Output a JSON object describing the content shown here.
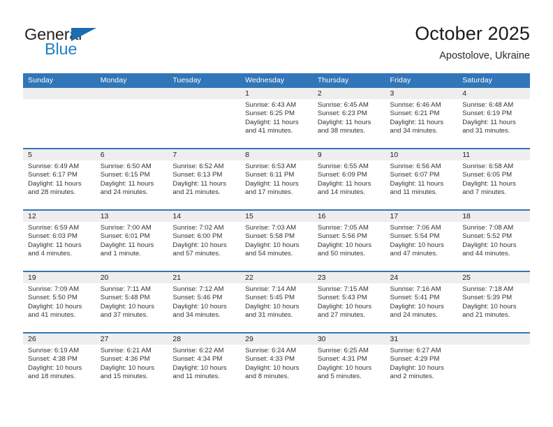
{
  "brand": {
    "name_part1": "General",
    "name_part2": "Blue",
    "color_dark": "#231f20",
    "color_blue": "#1f7fc4",
    "triangle_icon": "triangle-icon"
  },
  "header": {
    "title": "October 2025",
    "subtitle": "Apostolove, Ukraine"
  },
  "colors": {
    "header_blue": "#3176b8",
    "daystrip_gray": "#eeeeee",
    "text": "#333333"
  },
  "labels": {
    "sunrise": "Sunrise:",
    "sunset": "Sunset:",
    "daylight": "Daylight:"
  },
  "day_headers": [
    "Sunday",
    "Monday",
    "Tuesday",
    "Wednesday",
    "Thursday",
    "Friday",
    "Saturday"
  ],
  "weeks": [
    [
      {
        "day": "",
        "blank": true
      },
      {
        "day": "",
        "blank": true
      },
      {
        "day": "",
        "blank": true
      },
      {
        "day": "1",
        "sunrise": "Sunrise: 6:43 AM",
        "sunset": "Sunset: 6:25 PM",
        "daylight_l1": "Daylight: 11 hours",
        "daylight_l2": "and 41 minutes."
      },
      {
        "day": "2",
        "sunrise": "Sunrise: 6:45 AM",
        "sunset": "Sunset: 6:23 PM",
        "daylight_l1": "Daylight: 11 hours",
        "daylight_l2": "and 38 minutes."
      },
      {
        "day": "3",
        "sunrise": "Sunrise: 6:46 AM",
        "sunset": "Sunset: 6:21 PM",
        "daylight_l1": "Daylight: 11 hours",
        "daylight_l2": "and 34 minutes."
      },
      {
        "day": "4",
        "sunrise": "Sunrise: 6:48 AM",
        "sunset": "Sunset: 6:19 PM",
        "daylight_l1": "Daylight: 11 hours",
        "daylight_l2": "and 31 minutes."
      }
    ],
    [
      {
        "day": "5",
        "sunrise": "Sunrise: 6:49 AM",
        "sunset": "Sunset: 6:17 PM",
        "daylight_l1": "Daylight: 11 hours",
        "daylight_l2": "and 28 minutes."
      },
      {
        "day": "6",
        "sunrise": "Sunrise: 6:50 AM",
        "sunset": "Sunset: 6:15 PM",
        "daylight_l1": "Daylight: 11 hours",
        "daylight_l2": "and 24 minutes."
      },
      {
        "day": "7",
        "sunrise": "Sunrise: 6:52 AM",
        "sunset": "Sunset: 6:13 PM",
        "daylight_l1": "Daylight: 11 hours",
        "daylight_l2": "and 21 minutes."
      },
      {
        "day": "8",
        "sunrise": "Sunrise: 6:53 AM",
        "sunset": "Sunset: 6:11 PM",
        "daylight_l1": "Daylight: 11 hours",
        "daylight_l2": "and 17 minutes."
      },
      {
        "day": "9",
        "sunrise": "Sunrise: 6:55 AM",
        "sunset": "Sunset: 6:09 PM",
        "daylight_l1": "Daylight: 11 hours",
        "daylight_l2": "and 14 minutes."
      },
      {
        "day": "10",
        "sunrise": "Sunrise: 6:56 AM",
        "sunset": "Sunset: 6:07 PM",
        "daylight_l1": "Daylight: 11 hours",
        "daylight_l2": "and 11 minutes."
      },
      {
        "day": "11",
        "sunrise": "Sunrise: 6:58 AM",
        "sunset": "Sunset: 6:05 PM",
        "daylight_l1": "Daylight: 11 hours",
        "daylight_l2": "and 7 minutes."
      }
    ],
    [
      {
        "day": "12",
        "sunrise": "Sunrise: 6:59 AM",
        "sunset": "Sunset: 6:03 PM",
        "daylight_l1": "Daylight: 11 hours",
        "daylight_l2": "and 4 minutes."
      },
      {
        "day": "13",
        "sunrise": "Sunrise: 7:00 AM",
        "sunset": "Sunset: 6:01 PM",
        "daylight_l1": "Daylight: 11 hours",
        "daylight_l2": "and 1 minute."
      },
      {
        "day": "14",
        "sunrise": "Sunrise: 7:02 AM",
        "sunset": "Sunset: 6:00 PM",
        "daylight_l1": "Daylight: 10 hours",
        "daylight_l2": "and 57 minutes."
      },
      {
        "day": "15",
        "sunrise": "Sunrise: 7:03 AM",
        "sunset": "Sunset: 5:58 PM",
        "daylight_l1": "Daylight: 10 hours",
        "daylight_l2": "and 54 minutes."
      },
      {
        "day": "16",
        "sunrise": "Sunrise: 7:05 AM",
        "sunset": "Sunset: 5:56 PM",
        "daylight_l1": "Daylight: 10 hours",
        "daylight_l2": "and 50 minutes."
      },
      {
        "day": "17",
        "sunrise": "Sunrise: 7:06 AM",
        "sunset": "Sunset: 5:54 PM",
        "daylight_l1": "Daylight: 10 hours",
        "daylight_l2": "and 47 minutes."
      },
      {
        "day": "18",
        "sunrise": "Sunrise: 7:08 AM",
        "sunset": "Sunset: 5:52 PM",
        "daylight_l1": "Daylight: 10 hours",
        "daylight_l2": "and 44 minutes."
      }
    ],
    [
      {
        "day": "19",
        "sunrise": "Sunrise: 7:09 AM",
        "sunset": "Sunset: 5:50 PM",
        "daylight_l1": "Daylight: 10 hours",
        "daylight_l2": "and 41 minutes."
      },
      {
        "day": "20",
        "sunrise": "Sunrise: 7:11 AM",
        "sunset": "Sunset: 5:48 PM",
        "daylight_l1": "Daylight: 10 hours",
        "daylight_l2": "and 37 minutes."
      },
      {
        "day": "21",
        "sunrise": "Sunrise: 7:12 AM",
        "sunset": "Sunset: 5:46 PM",
        "daylight_l1": "Daylight: 10 hours",
        "daylight_l2": "and 34 minutes."
      },
      {
        "day": "22",
        "sunrise": "Sunrise: 7:14 AM",
        "sunset": "Sunset: 5:45 PM",
        "daylight_l1": "Daylight: 10 hours",
        "daylight_l2": "and 31 minutes."
      },
      {
        "day": "23",
        "sunrise": "Sunrise: 7:15 AM",
        "sunset": "Sunset: 5:43 PM",
        "daylight_l1": "Daylight: 10 hours",
        "daylight_l2": "and 27 minutes."
      },
      {
        "day": "24",
        "sunrise": "Sunrise: 7:16 AM",
        "sunset": "Sunset: 5:41 PM",
        "daylight_l1": "Daylight: 10 hours",
        "daylight_l2": "and 24 minutes."
      },
      {
        "day": "25",
        "sunrise": "Sunrise: 7:18 AM",
        "sunset": "Sunset: 5:39 PM",
        "daylight_l1": "Daylight: 10 hours",
        "daylight_l2": "and 21 minutes."
      }
    ],
    [
      {
        "day": "26",
        "sunrise": "Sunrise: 6:19 AM",
        "sunset": "Sunset: 4:38 PM",
        "daylight_l1": "Daylight: 10 hours",
        "daylight_l2": "and 18 minutes."
      },
      {
        "day": "27",
        "sunrise": "Sunrise: 6:21 AM",
        "sunset": "Sunset: 4:36 PM",
        "daylight_l1": "Daylight: 10 hours",
        "daylight_l2": "and 15 minutes."
      },
      {
        "day": "28",
        "sunrise": "Sunrise: 6:22 AM",
        "sunset": "Sunset: 4:34 PM",
        "daylight_l1": "Daylight: 10 hours",
        "daylight_l2": "and 11 minutes."
      },
      {
        "day": "29",
        "sunrise": "Sunrise: 6:24 AM",
        "sunset": "Sunset: 4:33 PM",
        "daylight_l1": "Daylight: 10 hours",
        "daylight_l2": "and 8 minutes."
      },
      {
        "day": "30",
        "sunrise": "Sunrise: 6:25 AM",
        "sunset": "Sunset: 4:31 PM",
        "daylight_l1": "Daylight: 10 hours",
        "daylight_l2": "and 5 minutes."
      },
      {
        "day": "31",
        "sunrise": "Sunrise: 6:27 AM",
        "sunset": "Sunset: 4:29 PM",
        "daylight_l1": "Daylight: 10 hours",
        "daylight_l2": "and 2 minutes."
      },
      {
        "day": "",
        "blank": true
      }
    ]
  ]
}
